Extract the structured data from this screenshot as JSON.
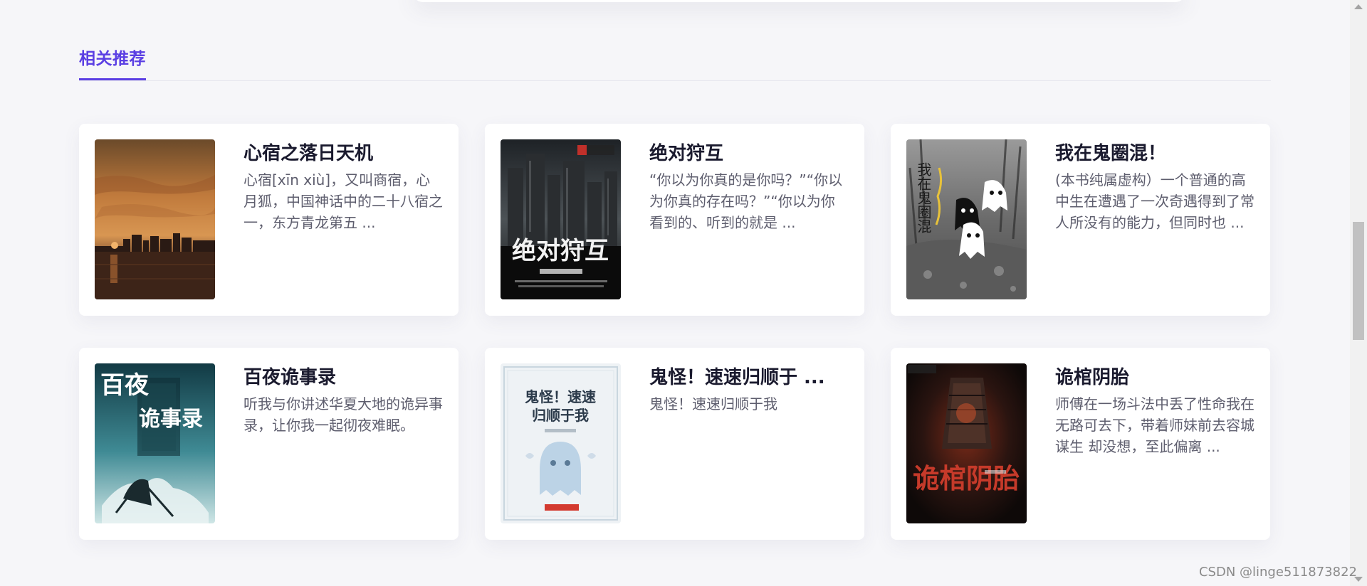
{
  "section": {
    "title": "相关推荐"
  },
  "books": [
    {
      "title": "心宿之落日天机",
      "desc": "心宿[xīn xiù]，又叫商宿，心月狐，中国神话中的二十八宿之一，东方青龙第五 ..."
    },
    {
      "title": "绝对狩互",
      "desc": "“你以为你真的是你吗？”“你以为你真的存在吗？”“你以为你看到的、听到的就是 ...",
      "cover_text": "绝对狩互"
    },
    {
      "title": "我在鬼圈混！",
      "desc": "(本书纯属虚构）一个普通的高中生在遭遇了一次奇遇得到了常人所没有的能力，但同时也 ...",
      "cover_text": "我在鬼圈混"
    },
    {
      "title": "百夜诡事录",
      "desc": "听我与你讲述华夏大地的诡异事录，让你我一起彻夜难眠。",
      "cover_text_1": "百夜",
      "cover_text_2": "诡事录"
    },
    {
      "title": "鬼怪！速速归顺于 ...",
      "desc": "鬼怪！速速归顺于我",
      "cover_text_1": "鬼怪！速速",
      "cover_text_2": "归顺于我"
    },
    {
      "title": "诡棺阴胎",
      "desc": "师傅在一场斗法中丢了性命我在无路可去下，带着师妹前去容城谋生 却没想，至此偏离 ...",
      "cover_text": "诡棺阴胎"
    }
  ],
  "watermark": "CSDN @linge511873822",
  "colors": {
    "accent": "#5b3fe3",
    "background": "#f6f6f9",
    "card": "#ffffff",
    "title_text": "#1a1a2e",
    "body_text": "#5e5e6e"
  }
}
